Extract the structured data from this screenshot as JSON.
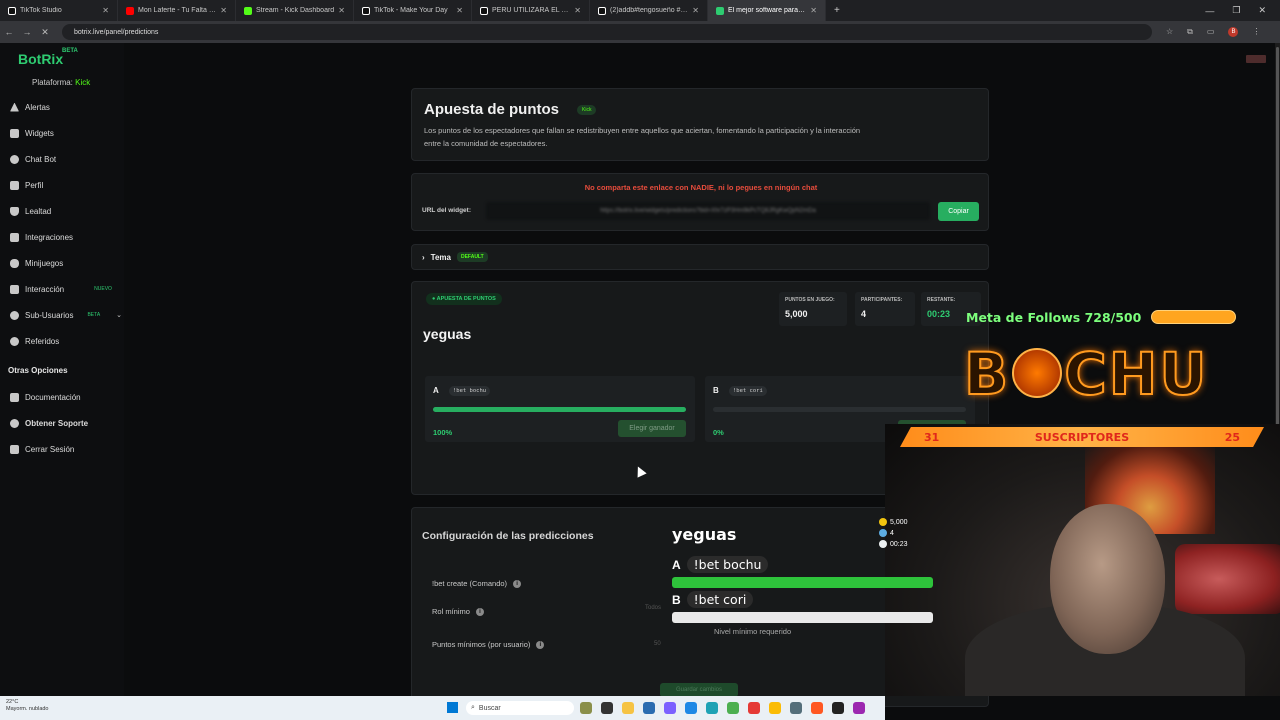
{
  "browser": {
    "tabs": [
      {
        "label": "TikTok Studio",
        "color": "#ffffff"
      },
      {
        "label": "Mon Laferte - Tu Falta De Q",
        "color": "#ff0000"
      },
      {
        "label": "Stream - Kick Dashboard",
        "color": "#53fc18"
      },
      {
        "label": "TikTok - Make Your Day",
        "color": "#ffffff"
      },
      {
        "label": "PERÚ UTILIZARÁ EL DINERO D",
        "color": "#ffffff"
      },
      {
        "label": "(2)addb#tengosueño #paratiiii",
        "color": "#ffffff"
      },
      {
        "label": "El mejor software para potencia",
        "color": "#2ecc71"
      }
    ],
    "new_tab": "+",
    "url": "botrix.live/panel/predictions",
    "profile_initial": "B"
  },
  "sidebar": {
    "brand": "BotRix",
    "brand_badge": "BETA",
    "platform_label": "Plataforma:",
    "platform_value": "Kick",
    "items": [
      {
        "label": "Alertas"
      },
      {
        "label": "Widgets"
      },
      {
        "label": "Chat Bot"
      },
      {
        "label": "Perfil"
      },
      {
        "label": "Lealtad"
      },
      {
        "label": "Integraciones"
      },
      {
        "label": "Minijuegos"
      },
      {
        "label": "Interacción",
        "badge": "NUEVO"
      },
      {
        "label": "Sub-Usuarios",
        "badge": "BETA"
      },
      {
        "label": "Referidos"
      }
    ],
    "other_title": "Otras Opciones",
    "other_items": [
      {
        "label": "Documentación"
      },
      {
        "label": "Obtener Soporte"
      },
      {
        "label": "Cerrar Sesión"
      }
    ]
  },
  "header": {
    "title": "Apuesta de puntos",
    "pill": "Kick",
    "description": "Los puntos de los espectadores que fallan se redistribuyen entre aquellos que aciertan, fomentando la participación y la interacción entre la comunidad de espectadores."
  },
  "widget_url": {
    "warning": "No comparta este enlace con NADIE, ni lo pegues en ningún chat",
    "label": "URL del widget:",
    "value": "https://botrix.live/widgets/predictions?bid=Xhr7zP3Hm9kPcTQ8JRgKwQpN2mDa",
    "copy_label": "Copiar"
  },
  "theme": {
    "label": "Tema",
    "pill": "DEFAULT"
  },
  "prediction": {
    "pill": "APUESTA DE PUNTOS",
    "stats": [
      {
        "label": "PUNTOS EN JUEGO:",
        "value": "5,000"
      },
      {
        "label": "PARTICIPANTES:",
        "value": "4"
      },
      {
        "label": "RESTANTE:",
        "value": "00:23"
      }
    ],
    "name": "yeguas",
    "options": [
      {
        "letter": "A",
        "command": "!bet bochu",
        "percent_label": "100%",
        "fill": 1.0,
        "button": "Elegir ganador"
      },
      {
        "letter": "B",
        "command": "!bet cori",
        "percent_label": "0%",
        "fill": 0.0,
        "button": "Elegir ganador"
      }
    ]
  },
  "config": {
    "title": "Configuración de las predicciones",
    "rows": [
      {
        "label": "!bet create (Comando)"
      },
      {
        "label": "Rol mínimo"
      },
      {
        "label": "Puntos mínimos (por usuario)"
      }
    ],
    "rol_value": "Todos",
    "points_value": "50",
    "right_label": "Nivel mínimo requerido",
    "save_label": "Guardar cambios"
  },
  "stream_overlay": {
    "follows_text": "Meta de Follows 728/500",
    "logo_left": "B",
    "logo_right": "CHU",
    "subs_left": "31",
    "subs_label": "SUSCRIPTORES",
    "subs_right": "25",
    "pred_title": "yeguas",
    "pred_points": "5,000",
    "pred_participants": "4",
    "pred_time": "00:23",
    "pred_a_letter": "A",
    "pred_a_cmd": "!bet bochu",
    "pred_b_letter": "B",
    "pred_b_cmd": "!bet cori"
  },
  "taskbar": {
    "weather_temp": "22°C",
    "weather_desc": "Mayorm. nublado",
    "search_placeholder": "Buscar"
  }
}
